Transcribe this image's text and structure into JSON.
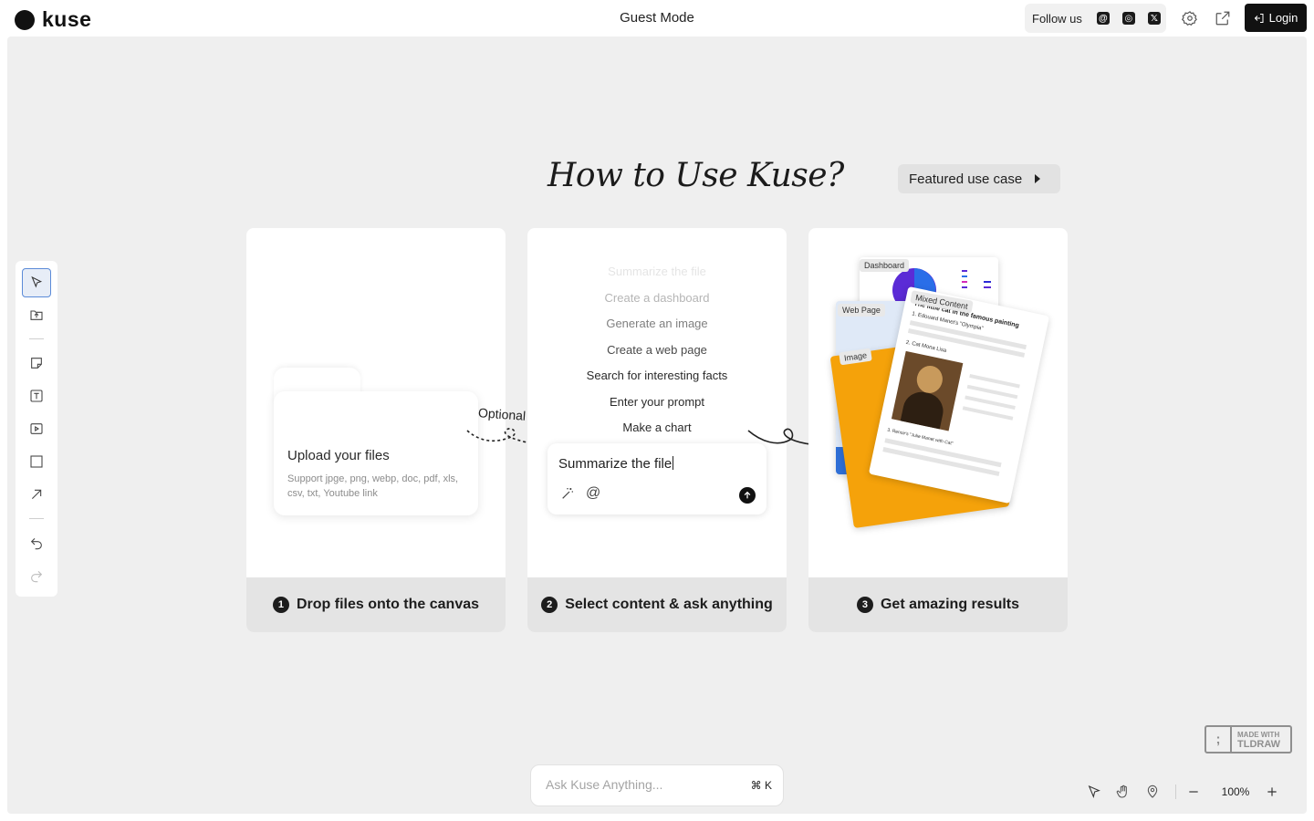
{
  "header": {
    "brand": "kuse",
    "mode": "Guest Mode",
    "follow_label": "Follow us",
    "social": [
      {
        "name": "threads",
        "glyph": "@"
      },
      {
        "name": "instagram",
        "glyph": "◎"
      },
      {
        "name": "x",
        "glyph": "𝕏"
      }
    ],
    "login_label": "Login"
  },
  "main": {
    "heading": "How to Use Kuse?",
    "featured_label": "Featured use case"
  },
  "steps": [
    {
      "number": "1",
      "title": "Drop files onto the canvas"
    },
    {
      "number": "2",
      "title": "Select content & ask anything"
    },
    {
      "number": "3",
      "title": "Get amazing results"
    }
  ],
  "upload": {
    "title": "Upload your files",
    "subtitle": "Support jpge, png, webp, doc, pdf, xls, csv, txt, Youtube link"
  },
  "optional_label": "Optional",
  "prompts": [
    {
      "text": "Summarize the file",
      "opacity": 0.12
    },
    {
      "text": "Create a dashboard",
      "opacity": 0.35
    },
    {
      "text": "Generate an image",
      "opacity": 0.6
    },
    {
      "text": "Create a web page",
      "opacity": 0.85
    },
    {
      "text": "Search for interesting facts",
      "opacity": 1
    },
    {
      "text": "Enter your prompt",
      "opacity": 1
    },
    {
      "text": "Make a chart",
      "opacity": 1
    }
  ],
  "ask_box": {
    "text": "Summarize the file"
  },
  "collage": {
    "dashboard": "Dashboard",
    "webpage": "Web Page",
    "image": "Image",
    "mixed": "Mixed Content",
    "doc_title": "The little cat in the famous painting",
    "item1": "1. Edouard Manet's \"Olympia\"",
    "item2": "2. Cat Mona Lisa",
    "item3": "3. Renoir's \"Julie Manet with Cat\""
  },
  "bottom": {
    "ask_placeholder": "Ask Kuse Anything...",
    "shortcut": "⌘ K",
    "zoom": "100%",
    "tldraw_top": "MADE WITH",
    "tldraw_bottom": "TLDRAW"
  },
  "colors": {
    "accent_orange": "#f5a20a",
    "accent_blue": "#2f6fd6",
    "tool_active_border": "#5b8bd8"
  }
}
